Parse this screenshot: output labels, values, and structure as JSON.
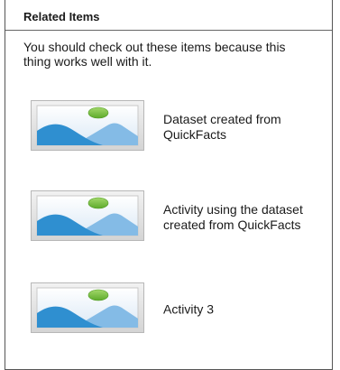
{
  "related": {
    "title": "Related Items",
    "description": "You should check out these items because this thing works well with it.",
    "thumbnail_icon": "image-placeholder-icon",
    "items": [
      {
        "label": "Dataset created from QuickFacts"
      },
      {
        "label": "Activity using the dataset created from QuickFacts"
      },
      {
        "label": "Activity 3"
      }
    ]
  },
  "colors": {
    "border": "#555555",
    "sky": "#e9f2fa",
    "mountain_front": "#2f8fd0",
    "mountain_back": "#7eb7e3",
    "sun": "#7cc241"
  }
}
